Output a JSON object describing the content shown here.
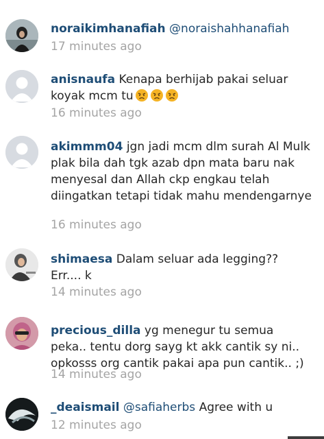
{
  "comments": [
    {
      "username": "noraikimhanafiah",
      "mention": "@noraishahhanafiah",
      "text": "",
      "time": "17 minutes ago",
      "avatar": "photo-avatar"
    },
    {
      "username": "anisnaufa",
      "mention": "",
      "text": "Kenapa berhijab pakai seluar koyak mcm tu",
      "emojis": [
        "angry-face-icon",
        "angry-face-icon",
        "angry-face-icon"
      ],
      "time": "16 minutes ago",
      "avatar": "default-avatar"
    },
    {
      "username": "akimmm04",
      "mention": "",
      "text": "jgn jadi mcm dlm surah Al Mulk plak bila dah tgk azab dpn mata baru nak menyesal dan Allah ckp engkau telah diingatkan tetapi tidak mahu mendengarnye",
      "time": "16 minutes ago",
      "avatar": "default-avatar"
    },
    {
      "username": "shimaesa",
      "mention": "",
      "text": "Dalam seluar ada legging?? Err.... k",
      "time": "14 minutes ago",
      "avatar": "photo-avatar"
    },
    {
      "username": "precious_dilla",
      "mention": "",
      "text": "yg menegur tu semua peka.. tentu dorg sayg kt akk cantik sy ni.. opkosss org cantik pakai apa pun cantik.. ;)",
      "time": "14 minutes ago",
      "avatar": "photo-avatar"
    },
    {
      "username": "_deaismail",
      "mention": "@safiaherbs",
      "text": "Agree with u",
      "time": "12 minutes ago",
      "avatar": "photo-avatar"
    }
  ],
  "colors": {
    "username": "#1e4d76",
    "text": "#262626",
    "timestamp": "#a4a4a4",
    "emoji": "#f5b324"
  }
}
